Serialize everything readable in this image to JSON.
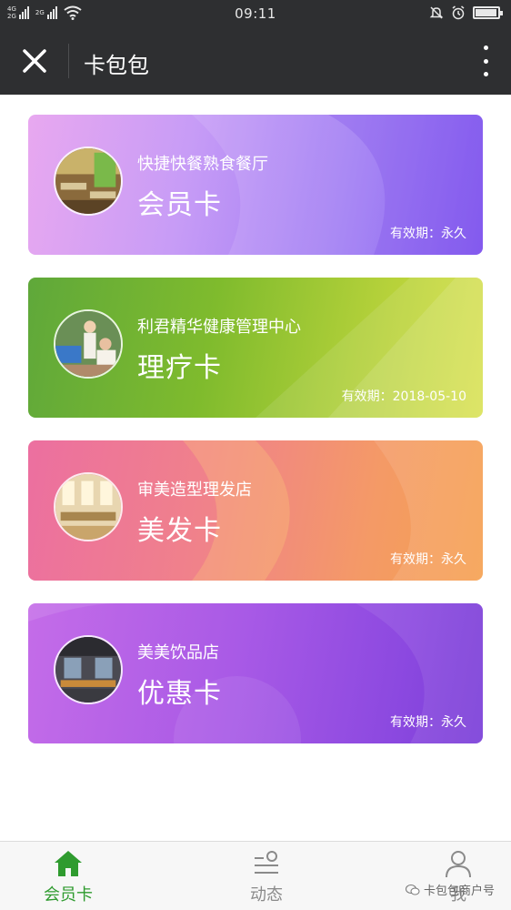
{
  "status_bar": {
    "network_top": "4G",
    "network_bottom": "2G",
    "network2_label": "2G",
    "time": "09:11",
    "icons": [
      "signal-icon",
      "wifi-icon",
      "mute-bell-icon",
      "alarm-icon",
      "battery-icon"
    ],
    "battery_level": 0.95
  },
  "nav": {
    "title": "卡包包",
    "close_icon": "close-icon",
    "more_icon": "more-vertical-icon"
  },
  "cards": [
    {
      "store": "快捷快餐熟食餐厅",
      "type": "会员卡",
      "valid_label": "有效期：",
      "valid_value": "永久",
      "image": "restaurant-photo"
    },
    {
      "store": "利君精华健康管理中心",
      "type": "理疗卡",
      "valid_label": "有效期：",
      "valid_value": "2018-05-10",
      "image": "spa-photo"
    },
    {
      "store": "审美造型理发店",
      "type": "美发卡",
      "valid_label": "有效期：",
      "valid_value": "永久",
      "image": "salon-photo"
    },
    {
      "store": "美美饮品店",
      "type": "优惠卡",
      "valid_label": "有效期：",
      "valid_value": "永久",
      "image": "cafe-photo"
    }
  ],
  "tabs": [
    {
      "label": "会员卡",
      "icon": "home-icon",
      "active": true
    },
    {
      "label": "动态",
      "icon": "feed-icon",
      "active": false
    },
    {
      "label": "我",
      "icon": "user-icon",
      "active": false
    }
  ],
  "watermark": "卡包包商户号",
  "colors": {
    "header_bg": "#2e2f31",
    "active_tab": "#2f9b2f",
    "inactive_tab": "#8a8a8a"
  }
}
